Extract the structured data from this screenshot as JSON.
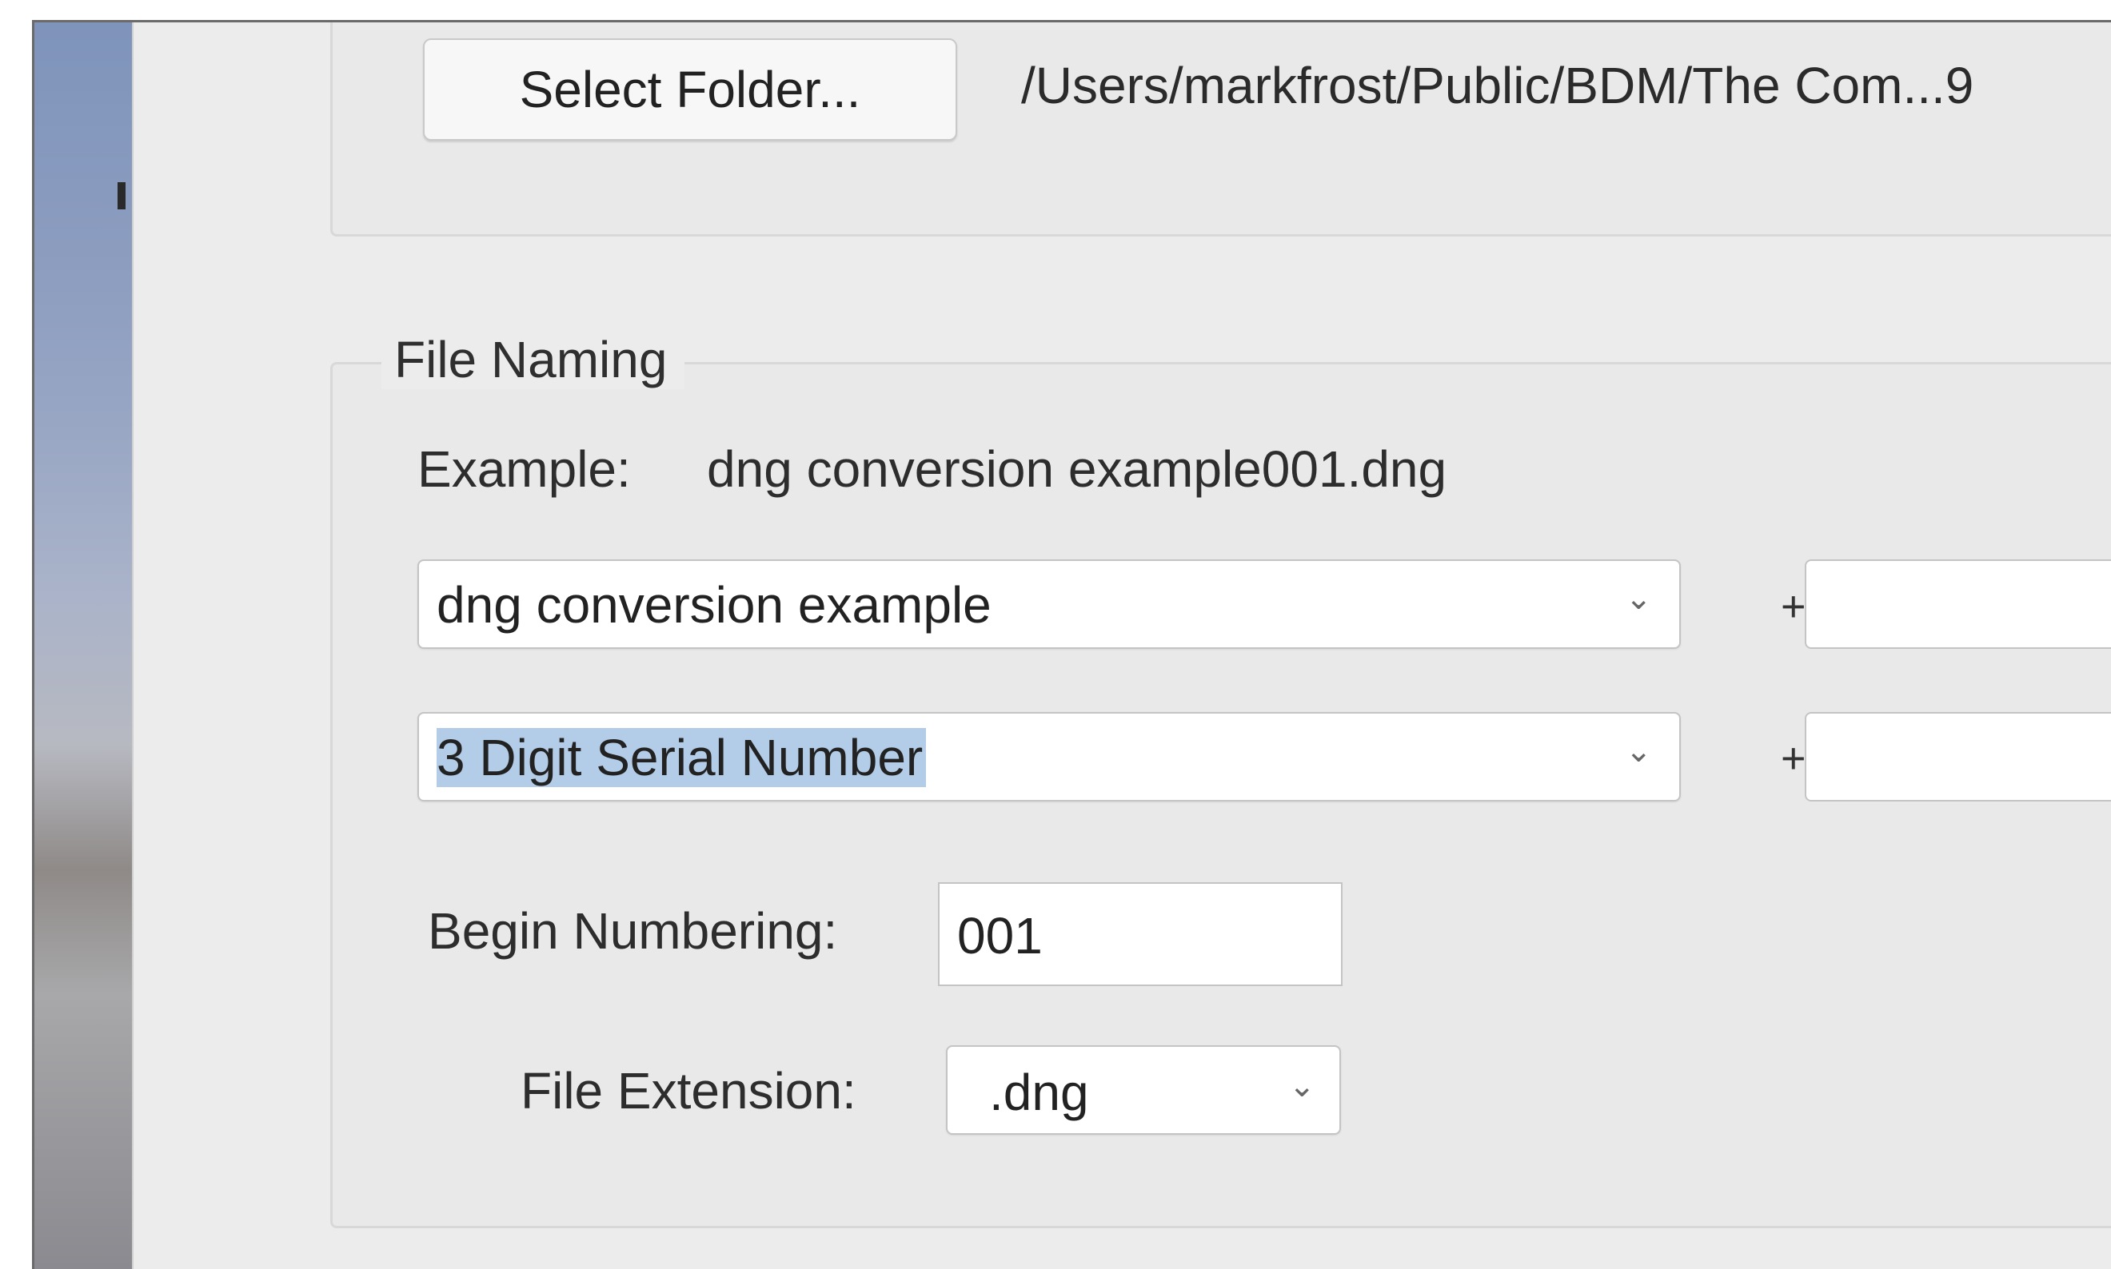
{
  "destination": {
    "select_folder_label": "Select Folder...",
    "path": "/Users/markfrost/Public/BDM/The Com...9"
  },
  "file_naming": {
    "group_title": "File Naming",
    "example_label": "Example:",
    "example_value": "dng conversion example001.dng",
    "rows": [
      {
        "selected": "dng conversion example",
        "plus": "+",
        "extra_value": ""
      },
      {
        "selected": "3 Digit Serial Number",
        "plus": "+",
        "extra_value": ""
      }
    ],
    "begin_numbering_label": "Begin Numbering:",
    "begin_numbering_value": "001",
    "file_extension_label": "File Extension:",
    "file_extension_value": ".dng"
  },
  "icons": {
    "dropdown": "chevron-down-icon"
  },
  "colors": {
    "selection_highlight": "#b3cde8",
    "dialog_background": "#ececec"
  }
}
